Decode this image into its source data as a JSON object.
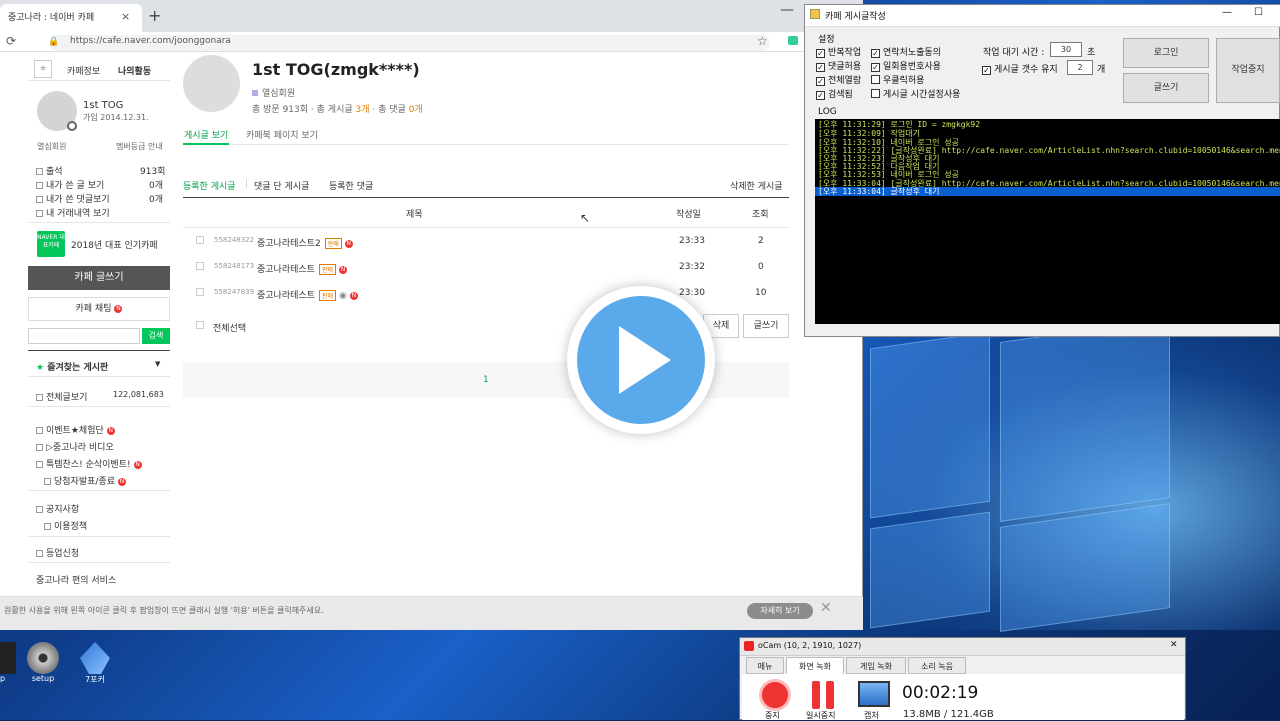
{
  "browser": {
    "tab_title": "중고나라 : 네이버 카페",
    "tab_close": "×",
    "new_tab": "+",
    "minimize": "—",
    "url": "https://cafe.naver.com/joonggonara"
  },
  "sidebar": {
    "tabs": [
      "카페정보",
      "나의활동"
    ],
    "user_name": "1st TOG",
    "join_date": "가입 2014.12.31.",
    "member_level": "열심회원",
    "level_guide": "멤버등급 안내",
    "stats": [
      {
        "label": "출석",
        "value": "913회"
      },
      {
        "label": "내가 쓴 글 보기",
        "value": "0개"
      },
      {
        "label": "내가 쓴 댓글보기",
        "value": "0개"
      },
      {
        "label": "내 거래내역 보기",
        "value": ""
      }
    ],
    "badge_text": "NAVER 대표카페",
    "popular_cafe": "2018년 대표 인기카페",
    "write_button": "카페 글쓰기",
    "chat_button": "카페 채팅",
    "search_button": "검색",
    "favorites": "즐겨찾는 게시판",
    "all_posts": "전체글보기",
    "all_posts_count": "122,081,683",
    "menu": [
      "이벤트★체험단",
      "▷중고나라 비디오",
      "특템찬스! 순삭이벤트!",
      "당첨자발표/종료"
    ],
    "menu2": [
      "공지사항",
      "이용정책"
    ],
    "business": "등업신청",
    "services": "중고나라 편의 서비스"
  },
  "main": {
    "title": "1st TOG(zmgk****)",
    "member_level": "열심회원",
    "visits_label": "총 방문",
    "visits": "913회",
    "posts_label": "· 총 게시글",
    "posts": "3개",
    "comments_label": "· 총 댓글",
    "comments": "0개",
    "tabs": [
      "게시글 보기",
      "카페북 페이지 보기"
    ],
    "sub_tabs": [
      "등록한 게시글",
      "댓글 단 게시글",
      "등록한 댓글"
    ],
    "deleted": "삭제한 게시글",
    "columns": {
      "title": "제목",
      "date": "작성일",
      "views": "조회"
    },
    "rows": [
      {
        "id": "558248322",
        "title": "중고나라테스트2",
        "tag": "판매",
        "date": "23:33",
        "views": "2"
      },
      {
        "id": "558248173",
        "title": "중고나라테스트",
        "tag": "판매",
        "date": "23:32",
        "views": "0"
      },
      {
        "id": "558247839",
        "title": "중고나라테스트",
        "tag": "판매",
        "date": "23:30",
        "views": "10"
      }
    ],
    "select_all": "전체선택",
    "delete_button": "삭제",
    "write_button": "글쓰기",
    "page": "1"
  },
  "notice": {
    "text": "원활한 사용을 위해 왼쪽 아이콘 클릭 후 팝업창이 뜨면 클래시 실행 '허용' 버튼을 클릭해주세요.",
    "button": "자세히 보기",
    "close": "✕"
  },
  "app": {
    "title": "카페 게시글작성",
    "minimize": "—",
    "maximize": "☐",
    "settings_label": "설정",
    "checks": [
      {
        "label": "반복작업",
        "checked": true
      },
      {
        "label": "연락처노출동의",
        "checked": true
      },
      {
        "label": "댓글허용",
        "checked": true
      },
      {
        "label": "일회용번호사용",
        "checked": true
      },
      {
        "label": "전체열람",
        "checked": true
      },
      {
        "label": "우클릭허용",
        "checked": false
      },
      {
        "label": "검색됨",
        "checked": true
      },
      {
        "label": "게시글 시간설정사용",
        "checked": false
      }
    ],
    "wait_label": "작업 대기 시간 :",
    "wait_value": "30",
    "wait_unit": "초",
    "keep_label": "게시글 갯수 유지",
    "keep_value": "2",
    "keep_unit": "개",
    "login_button": "로그인",
    "write_button": "글쓰기",
    "stop_button": "작업중지",
    "log_label": "LOG",
    "log_lines": [
      "[오후 11:31:29] 로그인 ID = zmgkgk92",
      "[오후 11:32:09] 작업대기",
      "[오후 11:32:10] 네이버 로그인 성공",
      "[오후 11:32:22] [글작성완료] http://cafe.naver.com/ArticleList.nhn?search.clubid=10050146&search.menuid=339&sear",
      "[오후 11:32:23] 글작성후 대기",
      "[오후 11:32:52] 다음작업 대기",
      "[오후 11:32:53] 네이버 로그인 성공",
      "[오후 11:33:04] [글작성완료] http://cafe.naver.com/ArticleList.nhn?search.clubid=10050146&search.menuid=424&sear",
      "[오후 11:33:04] 글작성후 대기"
    ]
  },
  "desktop_icons": [
    "setup",
    "7포커"
  ],
  "desktop_partial": "p",
  "ocam": {
    "title": "oCam (10, 2, 1910, 1027)",
    "close": "✕",
    "tabs": [
      "메뉴",
      "화면 녹화",
      "게임 녹화",
      "소리 녹음"
    ],
    "stop": "중지",
    "pause": "일시중지",
    "capture": "캡처",
    "time": "00:02:19",
    "size": "13.8MB / 121.4GB"
  }
}
